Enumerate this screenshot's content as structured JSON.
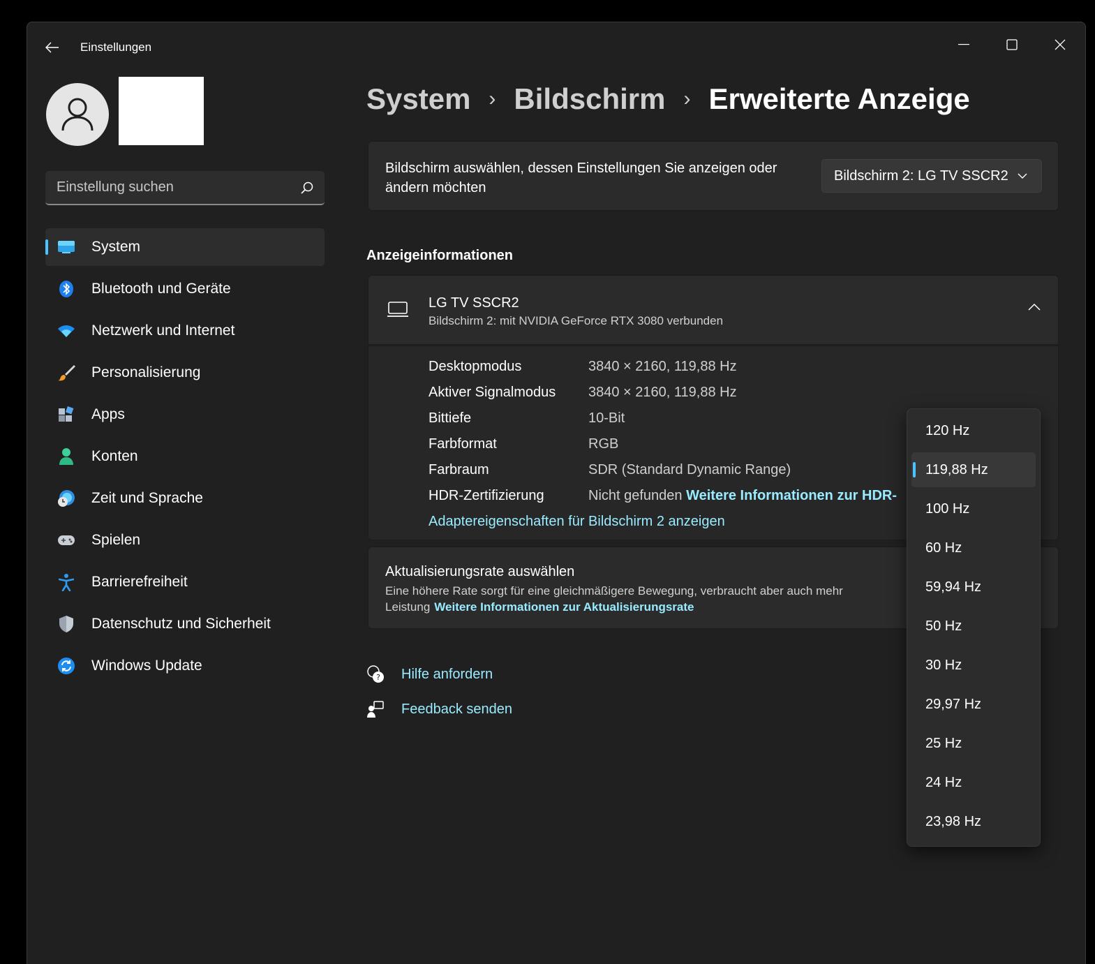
{
  "window": {
    "title": "Einstellungen"
  },
  "sidebar": {
    "search_placeholder": "Einstellung suchen",
    "items": [
      {
        "label": "System",
        "icon": "display-icon",
        "active": true
      },
      {
        "label": "Bluetooth und Geräte",
        "icon": "bluetooth-icon"
      },
      {
        "label": "Netzwerk und Internet",
        "icon": "wifi-icon"
      },
      {
        "label": "Personalisierung",
        "icon": "brush-icon"
      },
      {
        "label": "Apps",
        "icon": "apps-icon"
      },
      {
        "label": "Konten",
        "icon": "person-icon"
      },
      {
        "label": "Zeit und Sprache",
        "icon": "globe-clock-icon"
      },
      {
        "label": "Spielen",
        "icon": "gamepad-icon"
      },
      {
        "label": "Barrierefreiheit",
        "icon": "accessibility-icon"
      },
      {
        "label": "Datenschutz und Sicherheit",
        "icon": "shield-icon"
      },
      {
        "label": "Windows Update",
        "icon": "update-icon"
      }
    ]
  },
  "breadcrumb": {
    "level1": "System",
    "level2": "Bildschirm",
    "current": "Erweiterte Anzeige",
    "separator": "›"
  },
  "display_select": {
    "label": "Bildschirm auswählen, dessen Einstellungen Sie anzeigen oder ändern möchten",
    "value": "Bildschirm 2: LG TV SSCR2"
  },
  "display_info": {
    "section_title": "Anzeigeinformationen",
    "name": "LG TV SSCR2",
    "subtitle": "Bildschirm 2: mit NVIDIA GeForce RTX 3080 verbunden",
    "rows": [
      {
        "key": "Desktopmodus",
        "value": "3840 × 2160, 119,88 Hz"
      },
      {
        "key": "Aktiver Signalmodus",
        "value": "3840 × 2160, 119,88 Hz"
      },
      {
        "key": "Bittiefe",
        "value": "10-Bit"
      },
      {
        "key": "Farbformat",
        "value": "RGB"
      },
      {
        "key": "Farbraum",
        "value": "SDR (Standard Dynamic Range)"
      },
      {
        "key": "HDR-Zertifizierung",
        "value": "Nicht gefunden",
        "link": "Weitere Informationen zur HDR-"
      }
    ],
    "adapter_link": "Adaptereigenschaften für Bildschirm 2 anzeigen"
  },
  "refresh_rate": {
    "title": "Aktualisierungsrate auswählen",
    "description": "Eine höhere Rate sorgt für eine gleichmäßigere Bewegung, verbraucht aber auch mehr Leistung",
    "link": "Weitere Informationen zur Aktualisierungsrate",
    "options": [
      "120 Hz",
      "119,88 Hz",
      "100 Hz",
      "60 Hz",
      "59,94 Hz",
      "50 Hz",
      "30 Hz",
      "29,97 Hz",
      "25 Hz",
      "24 Hz",
      "23,98 Hz"
    ],
    "selected": "119,88 Hz"
  },
  "help": {
    "get_help": "Hilfe anfordern",
    "feedback": "Feedback senden"
  },
  "colors": {
    "accent": "#4cc2ff",
    "link": "#99ebff",
    "background": "#202020",
    "card": "#2b2b2b"
  }
}
